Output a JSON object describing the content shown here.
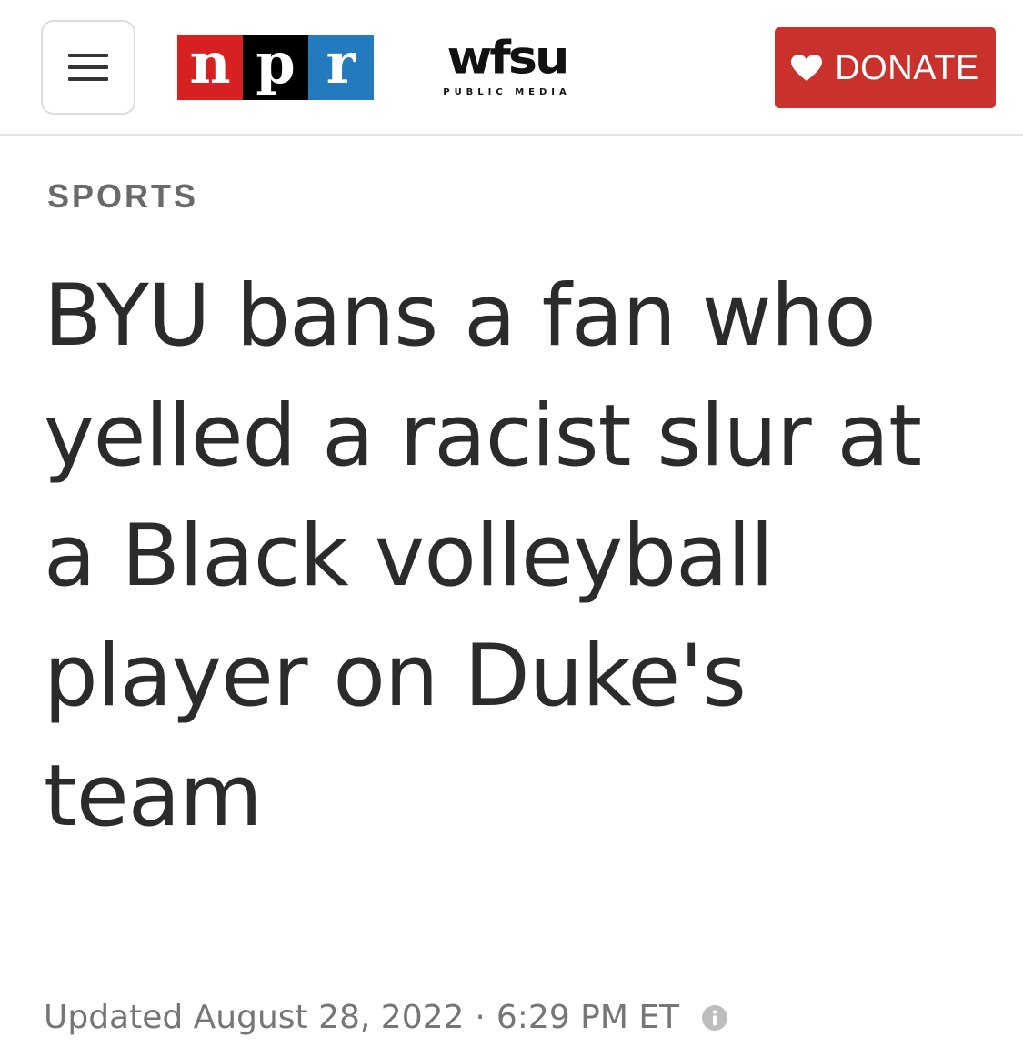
{
  "header": {
    "menu_icon": "hamburger-menu-icon",
    "npr_logo": {
      "letters": [
        "n",
        "p",
        "r"
      ],
      "colors": [
        "#d62021",
        "#000000",
        "#237bbd"
      ]
    },
    "station_logo": {
      "wordmark": "wfsu",
      "tagline": "PUBLIC MEDIA"
    },
    "donate": {
      "icon": "heart-icon",
      "label": "DONATE",
      "color": "#c8312c"
    }
  },
  "article": {
    "section": "SPORTS",
    "headline": "BYU bans a fan who yelled a racist slur at a Black volleyball player on Duke's team",
    "updated": "Updated August 28, 2022",
    "separator": "·",
    "time": "6:29 PM ET",
    "info_icon": "info-icon"
  }
}
